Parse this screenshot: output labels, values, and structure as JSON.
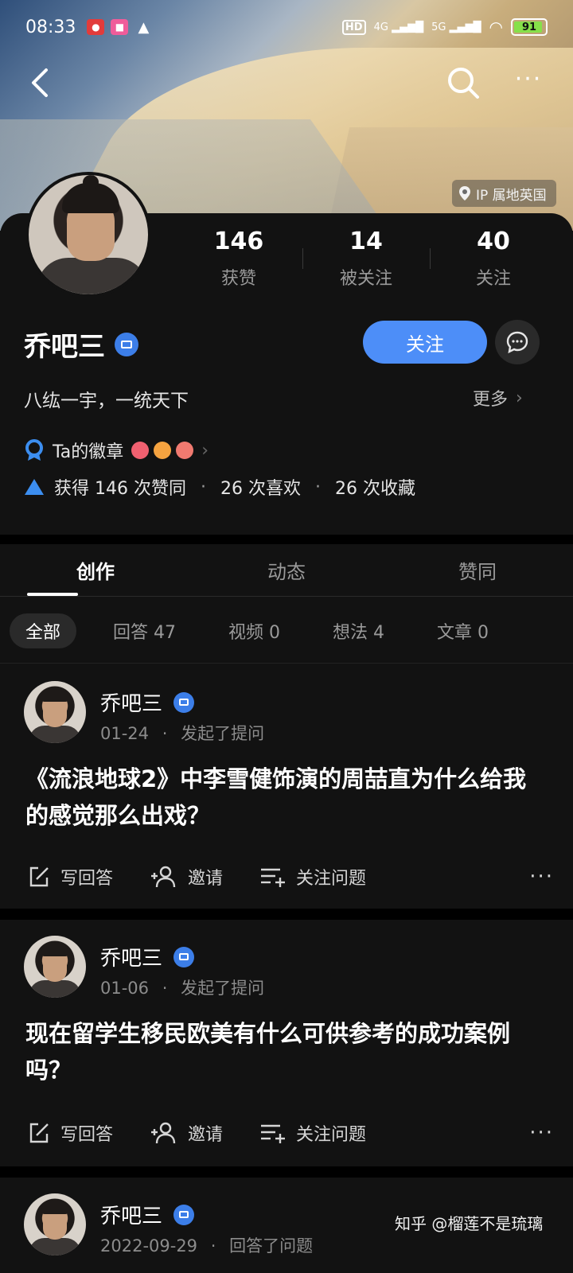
{
  "status_bar": {
    "time": "08:33",
    "left_icons": [
      "app-notification-icon",
      "app-notification-icon",
      "warning-icon"
    ],
    "right_text": [
      "HD",
      "4G",
      "5G"
    ],
    "battery": "91",
    "battery_level": 0.91
  },
  "top_nav": {
    "back_icon": "back-arrow-icon",
    "search_icon": "search-icon",
    "more_label": "···"
  },
  "cover": {
    "ip_label": "IP 属地英国"
  },
  "profile": {
    "stats": [
      {
        "value": "146",
        "label": "获赞"
      },
      {
        "value": "14",
        "label": "被关注"
      },
      {
        "value": "40",
        "label": "关注"
      }
    ],
    "name": "乔吧三",
    "follow_label": "关注",
    "bio": "八纮一宇，一统天下",
    "more_label": "更多",
    "badges_label": "Ta的徽章",
    "praise_summary": {
      "gained": "获得 146 次赞同",
      "likes": "26 次喜欢",
      "collects": "26 次收藏"
    }
  },
  "tabs": [
    "创作",
    "动态",
    "赞同"
  ],
  "filters": [
    "全部",
    "回答 47",
    "视频 0",
    "想法 4",
    "文章 0"
  ],
  "feed": [
    {
      "author": "乔吧三",
      "date": "01-24",
      "action": "发起了提问",
      "title": "《流浪地球2》中李雪健饰演的周喆直为什么给我的感觉那么出戏？",
      "actions": [
        "写回答",
        "邀请",
        "关注问题"
      ]
    },
    {
      "author": "乔吧三",
      "date": "01-06",
      "action": "发起了提问",
      "title": "现在留学生移民欧美有什么可供参考的成功案例吗？",
      "actions": [
        "写回答",
        "邀请",
        "关注问题"
      ]
    },
    {
      "author": "乔吧三",
      "date": "2022-09-29",
      "action": "回答了问题"
    }
  ],
  "watermark": "知乎 @榴莲不是琉璃",
  "colors": {
    "accent": "#4d8ef8",
    "background": "#121212",
    "verify": "#3c7ee8"
  }
}
